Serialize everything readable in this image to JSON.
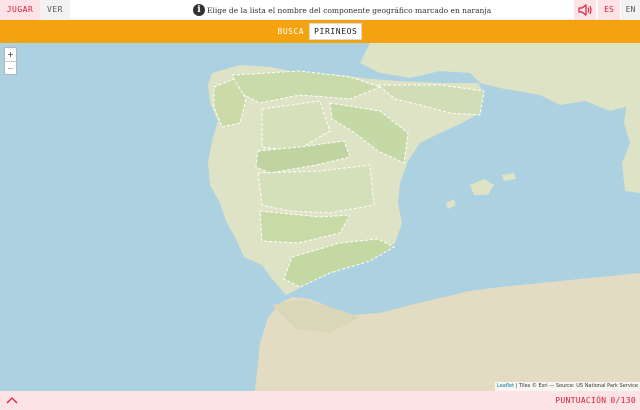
{
  "topbar": {
    "tabs": [
      {
        "label": "JUGAR",
        "active": true
      },
      {
        "label": "VER",
        "active": false
      }
    ],
    "instruction": "Elige de la lista el nombre del componente geográfico marcado en naranja",
    "info_icon": "i",
    "sound_icon": "speaker-icon",
    "languages": [
      {
        "label": "ES",
        "active": true
      },
      {
        "label": "EN",
        "active": false
      }
    ]
  },
  "search": {
    "label": "BUSCA",
    "target": "PIRINEOS"
  },
  "map": {
    "zoom_in": "+",
    "zoom_out": "−",
    "attribution_link": "Leaflet",
    "attribution_text": "| Tiles © Esri — Source: US National Park Service"
  },
  "footer": {
    "toggle_icon": "chevron-up-icon",
    "score_label": "PUNTUACIÓN",
    "score_value": "0/130"
  },
  "colors": {
    "accent": "#d81e3a",
    "accent_bg": "#fde3e6",
    "orange_bar": "#f5a210",
    "sea": "#acd1e0",
    "land": "#dfe3c6",
    "region_fill": "#d7e3b9"
  }
}
